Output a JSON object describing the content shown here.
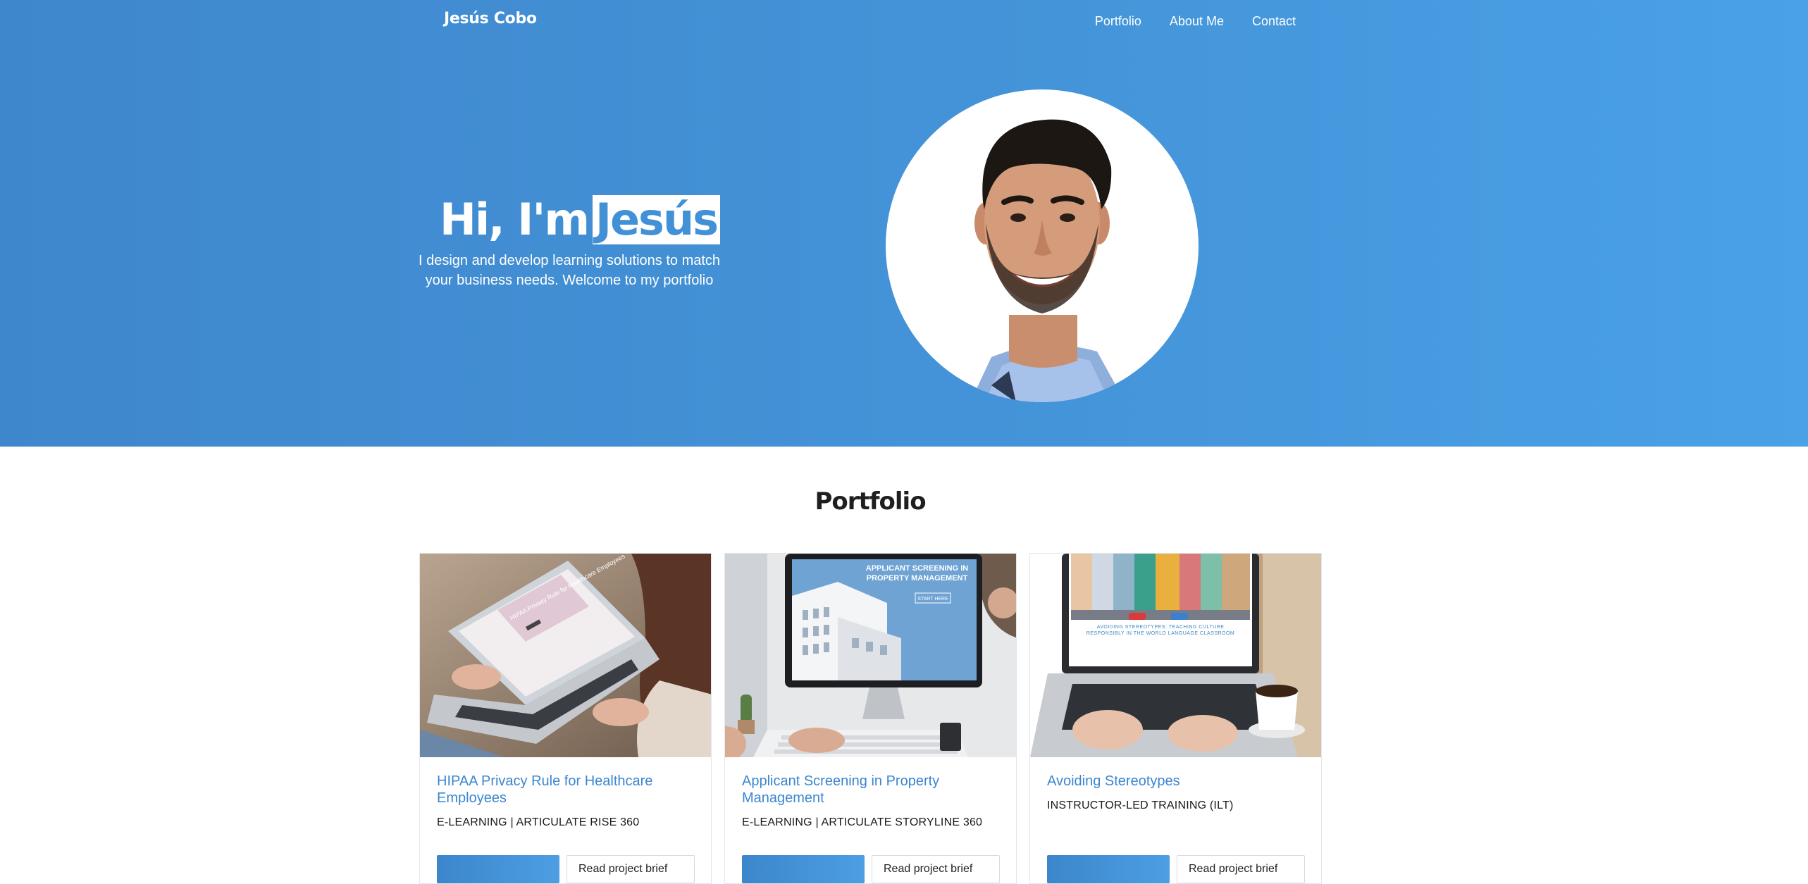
{
  "header": {
    "brand": "Jesús Cobo",
    "nav": [
      "Portfolio",
      "About Me",
      "Contact"
    ]
  },
  "hero": {
    "title_prefix": "Hi, I'm",
    "title_name": "Jesús",
    "subtitle": "I design and develop learning solutions to match your business needs. Welcome to my portfolio"
  },
  "portfolio": {
    "heading": "Portfolio",
    "cards": [
      {
        "title": "HIPAA Privacy Rule for Healthcare Employees",
        "meta": "E-LEARNING | ARTICULATE RISE 360",
        "thumb_icon": "laptop-on-lap-photo",
        "screen_text": "HIPAA Privacy Rule for Healthcare Employees",
        "primary_label": "",
        "secondary_label": "Read project brief"
      },
      {
        "title": "Applicant Screening in Property Management",
        "meta": "E-LEARNING | ARTICULATE STORYLINE 360",
        "thumb_icon": "desktop-monitor-photo",
        "screen_text": "APPLICANT SCREENING IN PROPERTY MANAGEMENT",
        "screen_button": "START HERE",
        "primary_label": "",
        "secondary_label": "Read project brief"
      },
      {
        "title": "Avoiding Stereotypes",
        "meta": "INSTRUCTOR-LED TRAINING (ILT)",
        "thumb_icon": "laptop-with-coffee-photo",
        "screen_text": "AVOIDING STEREOTYPES: TEACHING CULTURE RESPONSIBLY IN THE WORLD LANGUAGE CLASSROOM",
        "primary_label": "",
        "secondary_label": "Read project brief"
      }
    ]
  },
  "colors": {
    "hero_start": "#3f87cd",
    "hero_end": "#4aa1e6",
    "link_blue": "#3b86cf",
    "heading": "#1f1f1f"
  }
}
